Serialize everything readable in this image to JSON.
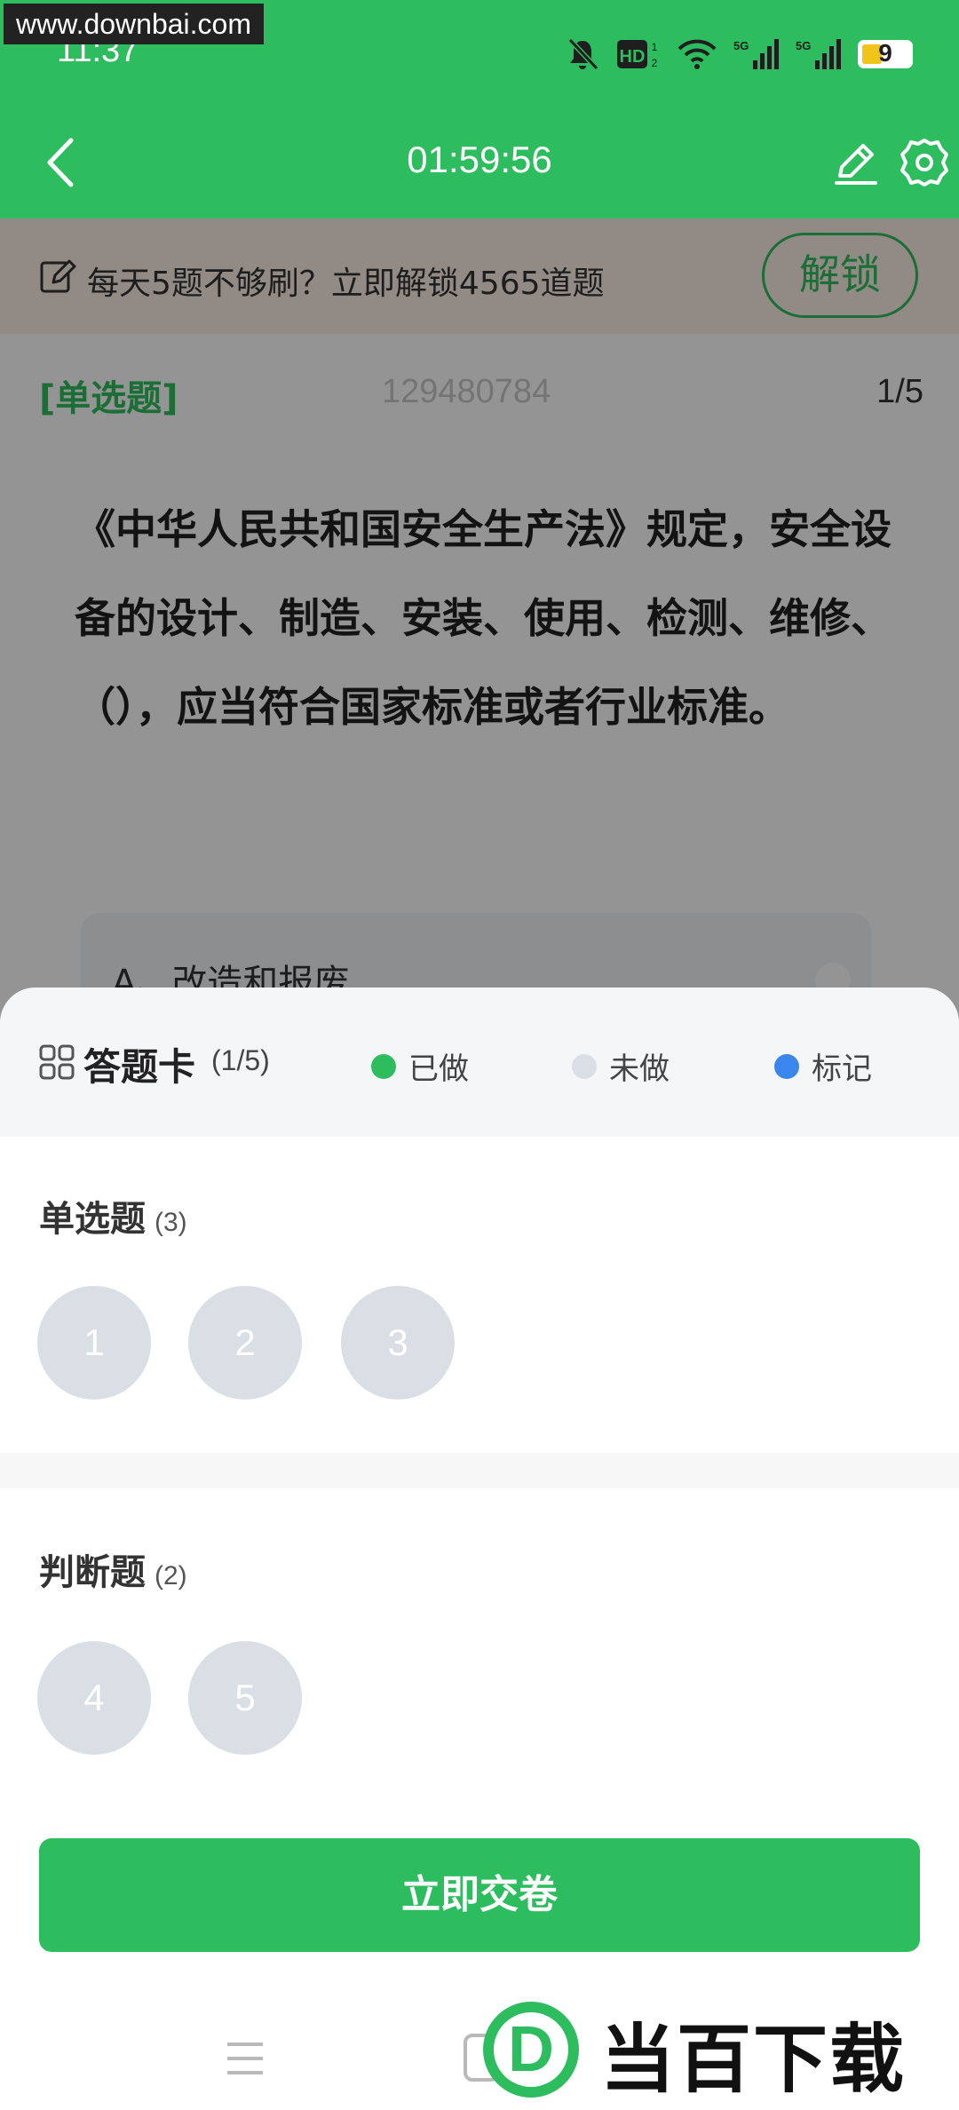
{
  "watermark": "www.downbai.com",
  "status_bar": {
    "time": "11:37",
    "battery": "9",
    "icons": [
      "bell-off-icon",
      "hd-icon",
      "wifi-icon",
      "signal-5g-icon",
      "signal-5g-icon",
      "battery-icon"
    ]
  },
  "header": {
    "timer": "01:59:56",
    "icons": [
      "back-icon",
      "edit-icon",
      "gear-icon"
    ]
  },
  "promo": {
    "text": "每天5题不够刷？立即解锁4565道题",
    "button": "解锁"
  },
  "question": {
    "type": "[单选题]",
    "id": "129480784",
    "progress": "1/5",
    "text": "《中华人民共和国安全生产法》规定，安全设备的设计、制造、安装、使用、检测、维修、（），应当符合国家标准或者行业标准。",
    "options": [
      {
        "label": "A、改造和报废"
      }
    ]
  },
  "answer_card": {
    "title": "答题卡",
    "count": "(1/5)",
    "legend": [
      {
        "label": "已做",
        "color": "#2ebd5e"
      },
      {
        "label": "未做",
        "color": "#dadfe6"
      },
      {
        "label": "标记",
        "color": "#3a86ee"
      }
    ],
    "sections": [
      {
        "title": "单选题",
        "count": "(3)",
        "questions": [
          "1",
          "2",
          "3"
        ]
      },
      {
        "title": "判断题",
        "count": "(2)",
        "questions": [
          "4",
          "5"
        ]
      }
    ],
    "submit": "立即交卷"
  },
  "brand": {
    "text": "当百下载",
    "logo_letter": "D"
  },
  "colors": {
    "primary_green": "#2ebd5e",
    "undone_gray": "#dadfe6",
    "marked_blue": "#3a86ee"
  }
}
